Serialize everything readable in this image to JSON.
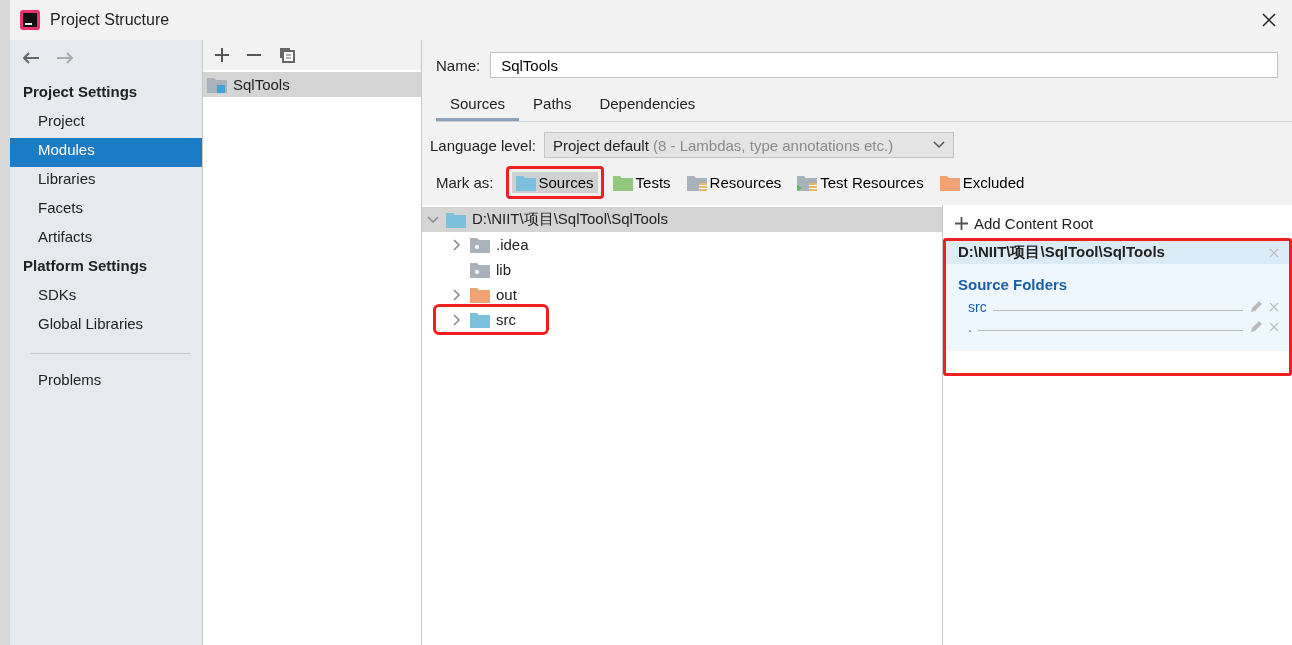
{
  "window": {
    "title": "Project Structure"
  },
  "sidebar": {
    "sections": [
      {
        "heading": "Project Settings",
        "items": [
          {
            "label": "Project",
            "selected": false
          },
          {
            "label": "Modules",
            "selected": true
          },
          {
            "label": "Libraries",
            "selected": false
          },
          {
            "label": "Facets",
            "selected": false
          },
          {
            "label": "Artifacts",
            "selected": false
          }
        ]
      },
      {
        "heading": "Platform Settings",
        "items": [
          {
            "label": "SDKs",
            "selected": false
          },
          {
            "label": "Global Libraries",
            "selected": false
          }
        ]
      }
    ],
    "footer_items": [
      {
        "label": "Problems",
        "selected": false
      }
    ]
  },
  "modules": {
    "items": [
      {
        "label": "SqlTools",
        "selected": true
      }
    ]
  },
  "name_field": {
    "label": "Name:",
    "value": "SqlTools"
  },
  "tabs": [
    {
      "label": "Sources",
      "selected": true
    },
    {
      "label": "Paths",
      "selected": false
    },
    {
      "label": "Dependencies",
      "selected": false
    }
  ],
  "language_level": {
    "label": "Language level:",
    "value": "Project default",
    "hint": "(8 - Lambdas, type annotations etc.)"
  },
  "mark_as": {
    "label": "Mark as:",
    "buttons": [
      {
        "label": "Sources",
        "kind": "sources",
        "selected": true,
        "annotated": true
      },
      {
        "label": "Tests",
        "kind": "tests",
        "selected": false,
        "annotated": false
      },
      {
        "label": "Resources",
        "kind": "resources",
        "selected": false,
        "annotated": false
      },
      {
        "label": "Test Resources",
        "kind": "test-resources",
        "selected": false,
        "annotated": false
      },
      {
        "label": "Excluded",
        "kind": "excluded",
        "selected": false,
        "annotated": false
      }
    ]
  },
  "tree": {
    "root": {
      "label": "D:\\NIIT\\项目\\SqlTool\\SqlTools",
      "kind": "sources",
      "has_children": true,
      "expanded": true,
      "selected": true,
      "annotated": false,
      "children": [
        {
          "label": ".idea",
          "kind": "plain",
          "has_children": true,
          "selected": false,
          "annotated": false
        },
        {
          "label": "lib",
          "kind": "plain",
          "has_children": false,
          "selected": false,
          "annotated": false
        },
        {
          "label": "out",
          "kind": "excluded",
          "has_children": true,
          "selected": false,
          "annotated": false
        },
        {
          "label": "src",
          "kind": "sources",
          "has_children": true,
          "selected": false,
          "annotated": true
        }
      ]
    }
  },
  "content_root": {
    "add_label": "Add Content Root",
    "path": "D:\\NIIT\\项目\\SqlTool\\SqlTools",
    "annotated": true,
    "section_title": "Source Folders",
    "folders": [
      {
        "label": "src"
      },
      {
        "label": "."
      }
    ]
  }
}
